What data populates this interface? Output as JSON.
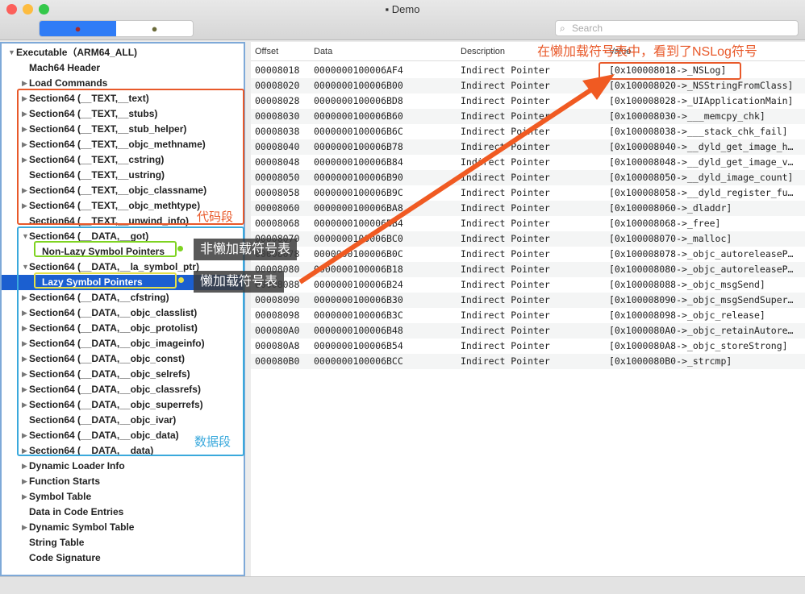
{
  "window": {
    "title": "Demo",
    "search_placeholder": "Search"
  },
  "tree": [
    {
      "label": "Executable（ARM64_ALL)",
      "level": 0,
      "arrow": "▼"
    },
    {
      "label": "Mach64 Header",
      "level": 1,
      "arrow": ""
    },
    {
      "label": "Load Commands",
      "level": 1,
      "arrow": "▶"
    },
    {
      "label": "Section64 (__TEXT,__text)",
      "level": 1,
      "arrow": "▶"
    },
    {
      "label": "Section64 (__TEXT,__stubs)",
      "level": 1,
      "arrow": "▶"
    },
    {
      "label": "Section64 (__TEXT,__stub_helper)",
      "level": 1,
      "arrow": "▶"
    },
    {
      "label": "Section64 (__TEXT,__objc_methname)",
      "level": 1,
      "arrow": "▶"
    },
    {
      "label": "Section64 (__TEXT,__cstring)",
      "level": 1,
      "arrow": "▶"
    },
    {
      "label": "Section64 (__TEXT,__ustring)",
      "level": 1,
      "arrow": ""
    },
    {
      "label": "Section64 (__TEXT,__objc_classname)",
      "level": 1,
      "arrow": "▶"
    },
    {
      "label": "Section64 (__TEXT,__objc_methtype)",
      "level": 1,
      "arrow": "▶"
    },
    {
      "label": "Section64 (__TEXT,__unwind_info)",
      "level": 1,
      "arrow": ""
    },
    {
      "label": "Section64 (__DATA,__got)",
      "level": 1,
      "arrow": "▼"
    },
    {
      "label": "Non-Lazy Symbol Pointers",
      "level": 2,
      "arrow": ""
    },
    {
      "label": "Section64 (__DATA,__la_symbol_ptr)",
      "level": 1,
      "arrow": "▼"
    },
    {
      "label": "Lazy Symbol Pointers",
      "level": 2,
      "arrow": "",
      "selected": true
    },
    {
      "label": "Section64 (__DATA,__cfstring)",
      "level": 1,
      "arrow": "▶"
    },
    {
      "label": "Section64 (__DATA,__objc_classlist)",
      "level": 1,
      "arrow": "▶"
    },
    {
      "label": "Section64 (__DATA,__objc_protolist)",
      "level": 1,
      "arrow": "▶"
    },
    {
      "label": "Section64 (__DATA,__objc_imageinfo)",
      "level": 1,
      "arrow": "▶"
    },
    {
      "label": "Section64 (__DATA,__objc_const)",
      "level": 1,
      "arrow": "▶"
    },
    {
      "label": "Section64 (__DATA,__objc_selrefs)",
      "level": 1,
      "arrow": "▶"
    },
    {
      "label": "Section64 (__DATA,__objc_classrefs)",
      "level": 1,
      "arrow": "▶"
    },
    {
      "label": "Section64 (__DATA,__objc_superrefs)",
      "level": 1,
      "arrow": "▶"
    },
    {
      "label": "Section64 (__DATA,__objc_ivar)",
      "level": 1,
      "arrow": ""
    },
    {
      "label": "Section64 (__DATA,__objc_data)",
      "level": 1,
      "arrow": "▶"
    },
    {
      "label": "Section64 (__DATA,__data)",
      "level": 1,
      "arrow": "▶"
    },
    {
      "label": "Dynamic Loader Info",
      "level": 1,
      "arrow": "▶"
    },
    {
      "label": "Function Starts",
      "level": 1,
      "arrow": "▶"
    },
    {
      "label": "Symbol Table",
      "level": 1,
      "arrow": "▶"
    },
    {
      "label": "Data in Code Entries",
      "level": 1,
      "arrow": ""
    },
    {
      "label": "Dynamic Symbol Table",
      "level": 1,
      "arrow": "▶"
    },
    {
      "label": "String Table",
      "level": 1,
      "arrow": ""
    },
    {
      "label": "Code Signature",
      "level": 1,
      "arrow": ""
    }
  ],
  "table": {
    "columns": [
      "Offset",
      "Data",
      "Description",
      "Value"
    ],
    "rows": [
      [
        "00008018",
        "0000000100006AF4",
        "Indirect Pointer",
        "[0x100008018->_NSLog]"
      ],
      [
        "00008020",
        "0000000100006B00",
        "Indirect Pointer",
        "[0x100008020->_NSStringFromClass]"
      ],
      [
        "00008028",
        "0000000100006BD8",
        "Indirect Pointer",
        "[0x100008028->_UIApplicationMain]"
      ],
      [
        "00008030",
        "0000000100006B60",
        "Indirect Pointer",
        "[0x100008030->___memcpy_chk]"
      ],
      [
        "00008038",
        "0000000100006B6C",
        "Indirect Pointer",
        "[0x100008038->___stack_chk_fail]"
      ],
      [
        "00008040",
        "0000000100006B78",
        "Indirect Pointer",
        "[0x100008040->__dyld_get_image_h…"
      ],
      [
        "00008048",
        "0000000100006B84",
        "Indirect Pointer",
        "[0x100008048->__dyld_get_image_v…"
      ],
      [
        "00008050",
        "0000000100006B90",
        "Indirect Pointer",
        "[0x100008050->__dyld_image_count]"
      ],
      [
        "00008058",
        "0000000100006B9C",
        "Indirect Pointer",
        "[0x100008058->__dyld_register_fu…"
      ],
      [
        "00008060",
        "0000000100006BA8",
        "Indirect Pointer",
        "[0x100008060->_dladdr]"
      ],
      [
        "00008068",
        "0000000100006BB4",
        "Indirect Pointer",
        "[0x100008068->_free]"
      ],
      [
        "00008070",
        "0000000100006BC0",
        "Indirect Pointer",
        "[0x100008070->_malloc]"
      ],
      [
        "00008078",
        "0000000100006B0C",
        "Indirect Pointer",
        "[0x100008078->_objc_autoreleaseP…"
      ],
      [
        "00008080",
        "0000000100006B18",
        "Indirect Pointer",
        "[0x100008080->_objc_autoreleaseP…"
      ],
      [
        "00008088",
        "0000000100006B24",
        "Indirect Pointer",
        "[0x100008088->_objc_msgSend]"
      ],
      [
        "00008090",
        "0000000100006B30",
        "Indirect Pointer",
        "[0x100008090->_objc_msgSendSuper…"
      ],
      [
        "00008098",
        "0000000100006B3C",
        "Indirect Pointer",
        "[0x100008098->_objc_release]"
      ],
      [
        "000080A0",
        "0000000100006B48",
        "Indirect Pointer",
        "[0x1000080A0->_objc_retainAutore…"
      ],
      [
        "000080A8",
        "0000000100006B54",
        "Indirect Pointer",
        "[0x1000080A8->_objc_storeStrong]"
      ],
      [
        "000080B0",
        "0000000100006BCC",
        "Indirect Pointer",
        "[0x1000080B0->_strcmp]"
      ]
    ]
  },
  "annotations": {
    "text_segment": "代码段",
    "data_segment": "数据段",
    "non_lazy": "非懒加载符号表",
    "lazy": "懒加载符号表",
    "top_note": "在懒加载符号表中，看到了NSLog符号"
  },
  "colors": {
    "orange": "#e8592a",
    "blue": "#3aa9dc",
    "green": "#7ed321",
    "yellow": "#e3e04a",
    "selection": "#1b5fd0"
  }
}
